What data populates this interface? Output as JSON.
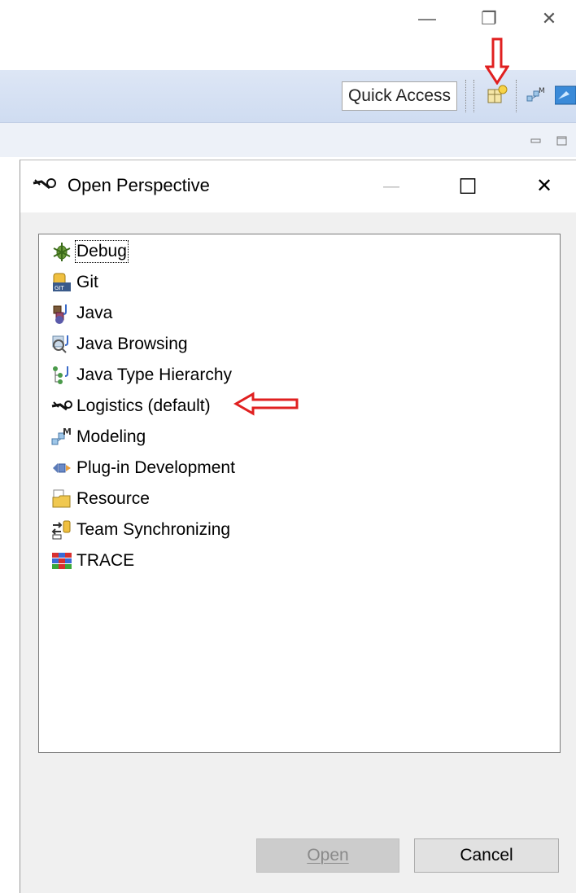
{
  "window_controls": {
    "minimize": "—",
    "restore": "❐",
    "close": "✕"
  },
  "toolbar": {
    "quick_access": "Quick Access",
    "icons": [
      "open-perspective-icon",
      "modeling-perspective-icon",
      "java-perspective-icon"
    ]
  },
  "dialog": {
    "title": "Open Perspective",
    "minimize": "—",
    "maximize": "☐",
    "close": "✕",
    "items": [
      {
        "label": "Debug",
        "icon": "debug-icon",
        "focused": true
      },
      {
        "label": "Git",
        "icon": "git-icon"
      },
      {
        "label": "Java",
        "icon": "java-icon"
      },
      {
        "label": "Java Browsing",
        "icon": "java-browsing-icon"
      },
      {
        "label": "Java Type Hierarchy",
        "icon": "java-type-hierarchy-icon"
      },
      {
        "label": "Logistics (default)",
        "icon": "logistics-icon"
      },
      {
        "label": "Modeling",
        "icon": "modeling-icon"
      },
      {
        "label": "Plug-in Development",
        "icon": "plugin-development-icon"
      },
      {
        "label": "Resource",
        "icon": "resource-icon"
      },
      {
        "label": "Team Synchronizing",
        "icon": "team-synchronizing-icon"
      },
      {
        "label": "TRACE",
        "icon": "trace-icon"
      }
    ],
    "open_button": "Open",
    "cancel_button": "Cancel"
  }
}
